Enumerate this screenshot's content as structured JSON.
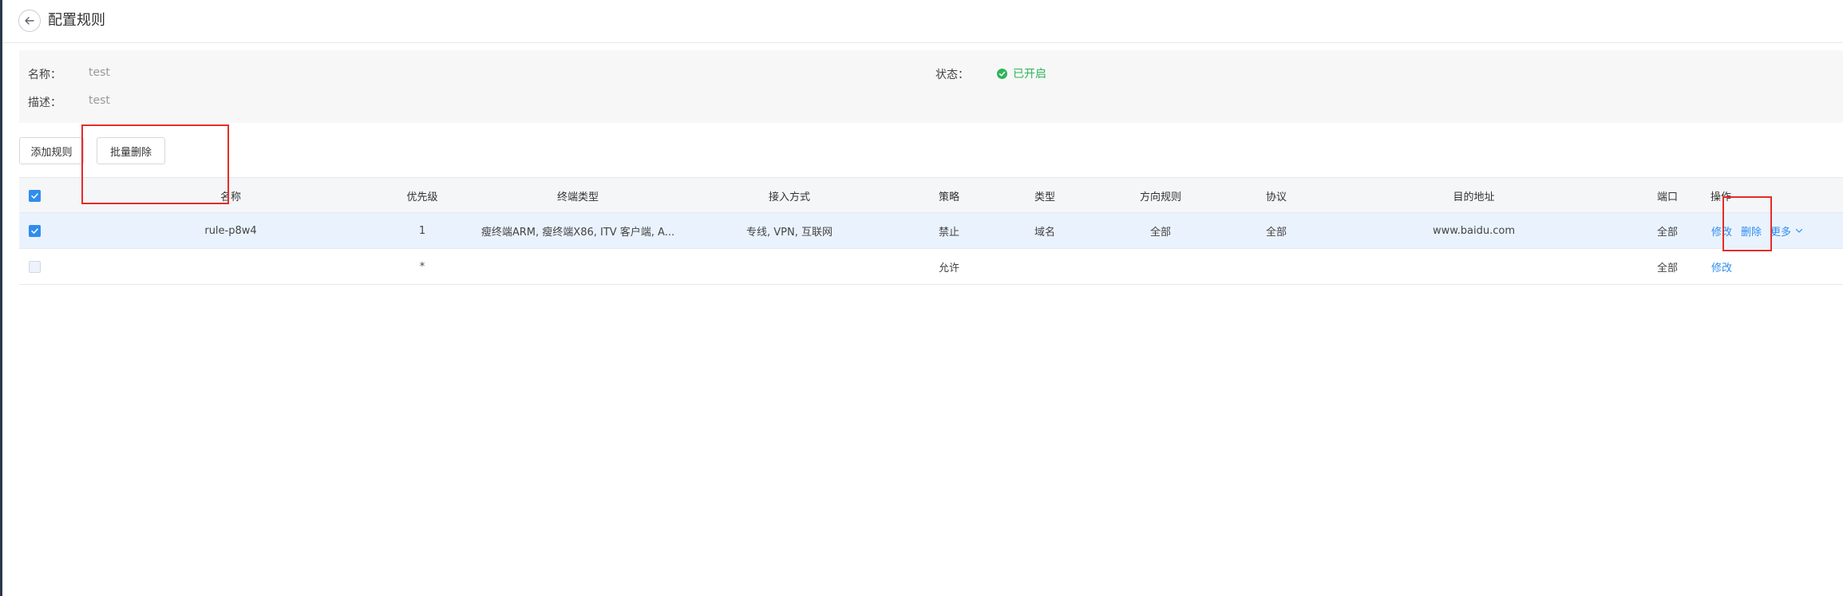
{
  "header": {
    "title": "配置规则",
    "back_icon": "arrow-left-icon"
  },
  "info": {
    "name_label": "名称：",
    "name_value": "test",
    "desc_label": "描述：",
    "desc_value": "test",
    "status_label": "状态：",
    "status_value": "已开启",
    "status_color": "#2fb35b"
  },
  "toolbar": {
    "add_label": "添加规则",
    "batch_delete_label": "批量删除"
  },
  "table": {
    "columns": [
      "名称",
      "优先级",
      "终端类型",
      "接入方式",
      "策略",
      "类型",
      "方向规则",
      "协议",
      "目的地址",
      "端口",
      "操作"
    ],
    "rows": [
      {
        "checked": true,
        "name": "rule-p8w4",
        "priority": "1",
        "terminal_type": "瘦终端ARM, 瘦终端X86, ITV 客户端, A...",
        "access": "专线, VPN, 互联网",
        "policy": "禁止",
        "type": "域名",
        "direction": "全部",
        "protocol": "全部",
        "destination": "www.baidu.com",
        "port": "全部",
        "actions": {
          "edit": "修改",
          "delete": "删除",
          "more": "更多"
        }
      },
      {
        "checked": false,
        "name": "",
        "priority": "*",
        "terminal_type": "",
        "access": "",
        "policy": "允许",
        "type": "",
        "direction": "",
        "protocol": "",
        "destination": "",
        "port": "全部",
        "actions": {
          "edit": "修改"
        }
      }
    ]
  },
  "colors": {
    "accent": "#2f8cf0",
    "annotation": "#e52b2b"
  }
}
